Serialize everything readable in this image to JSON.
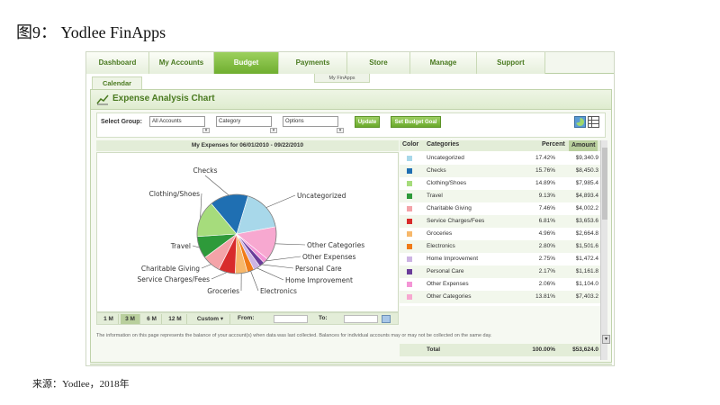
{
  "figure": {
    "title": "图9：  Yodlee FinApps",
    "source": "来源：Yodlee，2018年"
  },
  "nav": {
    "tabs": [
      "Dashboard",
      "My Accounts",
      "Budget",
      "Payments",
      "Store",
      "Manage",
      "Support"
    ],
    "active_tab": "Budget",
    "subtab": "My FinApps",
    "calendar": "Calendar"
  },
  "panel": {
    "title": "Expense Analysis Chart"
  },
  "filters": {
    "label": "Select Group:",
    "group_value": "All Accounts",
    "category_value": "Category",
    "options_value": "Options",
    "update_label": "Update",
    "goal_label": "Set Budget Goal"
  },
  "chart": {
    "title": "My Expenses for 06/01/2010 - 09/22/2010"
  },
  "table": {
    "headers": {
      "color": "Color",
      "categories": "Categories",
      "percent": "Percent",
      "amount": "Amount"
    },
    "total_label": "Total",
    "total_percent": "100.00%",
    "total_amount": "$53,624.0"
  },
  "range": {
    "buttons": [
      "1 M",
      "3 M",
      "6 M",
      "12 M",
      "Custom ▾"
    ],
    "active": "3 M",
    "from_label": "From:",
    "to_label": "To:"
  },
  "footnote": "The information on this page represents the balance of your account(s) when data was last collected. Balances for individual accounts may or may not be collected on the same day.",
  "chart_data": {
    "type": "pie",
    "title": "My Expenses for 06/01/2010 - 09/22/2010",
    "categories": [
      "Uncategorized",
      "Checks",
      "Clothing/Shoes",
      "Travel",
      "Charitable Giving",
      "Service Charges/Fees",
      "Groceries",
      "Electronics",
      "Home Improvement",
      "Personal Care",
      "Other Expenses",
      "Other Categories"
    ],
    "values": [
      17.42,
      15.76,
      14.89,
      9.13,
      7.46,
      6.81,
      4.96,
      2.8,
      2.75,
      2.17,
      2.06,
      13.81
    ],
    "percent_labels": [
      "17.42%",
      "15.76%",
      "14.89%",
      "9.13%",
      "7.46%",
      "6.81%",
      "4.96%",
      "2.80%",
      "2.75%",
      "2.17%",
      "2.06%",
      "13.81%"
    ],
    "amounts": [
      "$9,340.9",
      "$8,450.3",
      "$7,985.4",
      "$4,893.4",
      "$4,002.2",
      "$3,653.6",
      "$2,664.8",
      "$1,501.6",
      "$1,472.4",
      "$1,161.8",
      "$1,104.0",
      "$7,403.2"
    ],
    "colors": [
      "#a8d8ea",
      "#1f6fb2",
      "#a6dc7c",
      "#2e9a3a",
      "#f4a3a8",
      "#d82c2c",
      "#f7b86b",
      "#f07b18",
      "#cdb4e3",
      "#6a3d9a",
      "#f495d6",
      "#f7a8d0"
    ],
    "legend": "right"
  }
}
